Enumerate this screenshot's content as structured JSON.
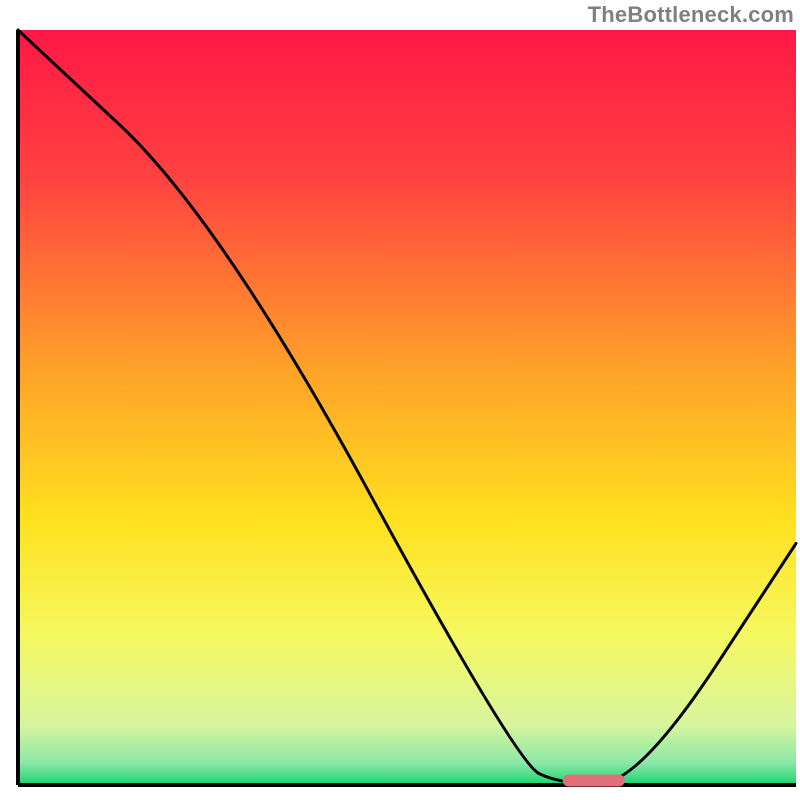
{
  "watermark": {
    "text": "TheBottleneck.com"
  },
  "chart_data": {
    "type": "line",
    "title": "",
    "xlabel": "",
    "ylabel": "",
    "xlim": [
      0,
      100
    ],
    "ylim": [
      0,
      100
    ],
    "x": [
      0,
      26,
      64,
      70,
      80,
      100
    ],
    "values": [
      100,
      75,
      3,
      0,
      0.5,
      32
    ],
    "marker": {
      "x_range": [
        70,
        78
      ],
      "y": 0.6
    },
    "background_gradient": {
      "stops": [
        {
          "pos": 0.0,
          "color": "#ff1846"
        },
        {
          "pos": 0.2,
          "color": "#ff4340"
        },
        {
          "pos": 0.45,
          "color": "#ffa229"
        },
        {
          "pos": 0.65,
          "color": "#ffe11f"
        },
        {
          "pos": 0.8,
          "color": "#f6f85f"
        },
        {
          "pos": 0.92,
          "color": "#d8f59d"
        },
        {
          "pos": 0.97,
          "color": "#8de8a8"
        },
        {
          "pos": 1.0,
          "color": "#1bd46f"
        }
      ]
    },
    "axes_color": "#000000",
    "line_color": "#000000",
    "line_width": 3,
    "marker_color": "#e07077"
  }
}
